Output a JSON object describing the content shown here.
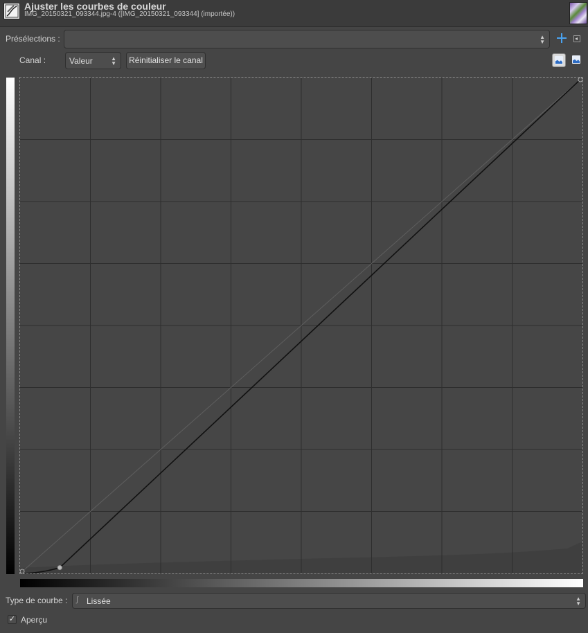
{
  "window": {
    "title": "Ajuster les courbes de couleur",
    "subtitle": "IMG_20150321_093344.jpg-4 ([IMG_20150321_093344] (importée))"
  },
  "presets": {
    "label": "Présélections :",
    "value": ""
  },
  "channel": {
    "label": "Canal :",
    "value": "Valeur",
    "reset_label": "Réinitialiser le canal"
  },
  "curve_type": {
    "label": "Type de courbe :",
    "value": "Lissée"
  },
  "preview": {
    "label": "Aperçu",
    "checked": true,
    "check_glyph": "✓"
  },
  "icons": {
    "tool": "curves-tool-icon",
    "add": "plus-icon",
    "menu": "menu-arrow-icon",
    "hist_linear": "histogram-linear-icon",
    "hist_log": "histogram-log-icon",
    "smooth": "smooth-curve-icon"
  },
  "colors": {
    "accent": "#4aa3f0",
    "curve": "#111111",
    "grid": "#2e2e2e"
  },
  "curve": {
    "input_range": [
      0,
      255
    ],
    "output_range": [
      0,
      255
    ],
    "control_points": [
      {
        "in": 0,
        "out": 0
      },
      {
        "in": 18,
        "out": 3
      },
      {
        "in": 255,
        "out": 255
      }
    ]
  }
}
